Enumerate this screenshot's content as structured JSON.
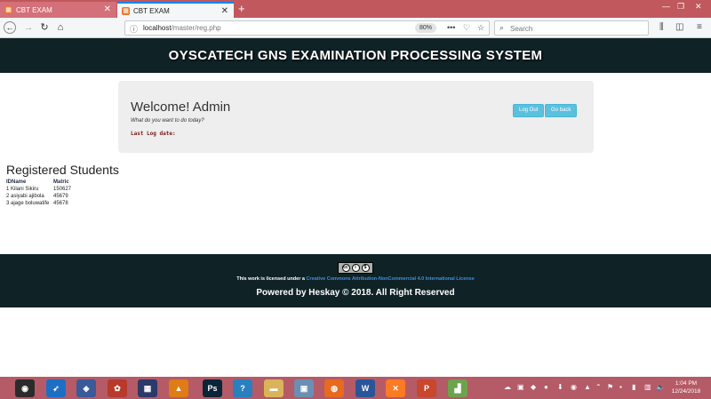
{
  "browser": {
    "tabs": [
      {
        "title": "CBT EXAM",
        "active": false
      },
      {
        "title": "CBT EXAM",
        "active": true
      }
    ],
    "url_host": "localhost",
    "url_path": "/master/reg.php",
    "zoom": "80%",
    "search_placeholder": "Search"
  },
  "page": {
    "site_title": "OYSCATECH GNS EXAMINATION PROCESSING SYSTEM",
    "welcome": {
      "heading": "Welcome! Admin",
      "subtitle": "What do you want to do today?",
      "last_log": "Last Log date:",
      "logout_label": "Log Out",
      "goback_label": "Go back"
    },
    "registered_title": "Registered Students",
    "table": {
      "headers": [
        "IDName",
        "Matric"
      ],
      "rows": [
        {
          "id_name": "1 Kilani Sikiru",
          "matric": "150627"
        },
        {
          "id_name": "2 asiyabi ajibola",
          "matric": "45679"
        },
        {
          "id_name": "3 ajage boluwatife",
          "matric": "45678"
        }
      ]
    },
    "footer": {
      "cc_badge": [
        "cc",
        "i",
        "$"
      ],
      "license_prefix": "This work is licensed under a ",
      "license_link": "Creative Commons Attribution-NonCommercial 4.0 International License",
      "powered": "Powered by Heskay © 2018. All Right Reserved"
    }
  },
  "taskbar": {
    "apps": [
      {
        "name": "start-icon",
        "color": "#2b2b2b",
        "glyph": "◉"
      },
      {
        "name": "rocket-icon",
        "color": "#1d6fc4",
        "glyph": "➶"
      },
      {
        "name": "shield-icon",
        "color": "#3a5a9a",
        "glyph": "◈"
      },
      {
        "name": "paint-icon",
        "color": "#b83a2a",
        "glyph": "✿"
      },
      {
        "name": "film-icon",
        "color": "#2a3a6a",
        "glyph": "▦"
      },
      {
        "name": "vlc-icon",
        "color": "#e07b16",
        "glyph": "▲"
      },
      {
        "name": "photoshop-icon",
        "color": "#0a2438",
        "glyph": "Ps"
      },
      {
        "name": "help-icon",
        "color": "#2a7fbf",
        "glyph": "?"
      },
      {
        "name": "folder-icon",
        "color": "#d9b45a",
        "glyph": "▬"
      },
      {
        "name": "network-icon",
        "color": "#6a8fb3",
        "glyph": "▣"
      },
      {
        "name": "firefox-icon",
        "color": "#e86a1f",
        "glyph": "◍"
      },
      {
        "name": "word-icon",
        "color": "#2a5699",
        "glyph": "W"
      },
      {
        "name": "xampp-icon",
        "color": "#fb7a24",
        "glyph": "✕"
      },
      {
        "name": "powerpoint-icon",
        "color": "#c8472d",
        "glyph": "P"
      },
      {
        "name": "chart-app-icon",
        "color": "#6da34d",
        "glyph": "▟"
      }
    ],
    "time": "1:04 PM",
    "date": "12/24/2018"
  }
}
